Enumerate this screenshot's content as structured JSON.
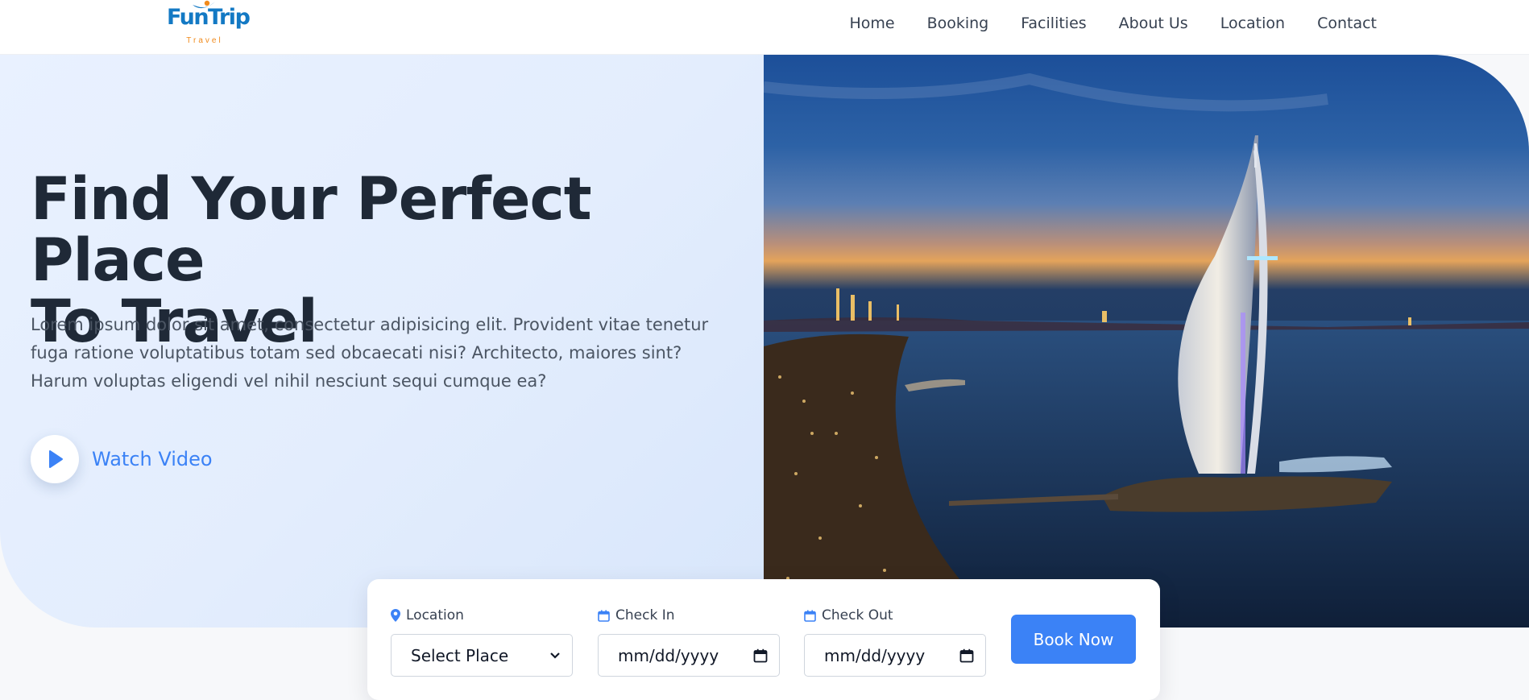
{
  "brand": {
    "name": "FunTrip",
    "tagline": "Travel",
    "primary_color": "#1379c4",
    "accent_color": "#f08a1c"
  },
  "nav": {
    "items": [
      {
        "label": "Home"
      },
      {
        "label": "Booking"
      },
      {
        "label": "Facilities"
      },
      {
        "label": "About Us"
      },
      {
        "label": "Location"
      },
      {
        "label": "Contact"
      }
    ]
  },
  "hero": {
    "title_line1": "Find Your Perfect Place",
    "title_line2": "To Travel",
    "description": "Lorem ipsum dolor sit amet, consectetur adipisicing elit. Provident vitae tenetur fuga ratione voluptatibus totam sed obcaecati nisi? Architecto, maiores sint? Harum voluptas eligendi vel nihil nesciunt sequi cumque ea?",
    "watch_video_label": "Watch Video",
    "image_icon": "burj-al-arab-night-photo"
  },
  "booking": {
    "location": {
      "label": "Location",
      "icon": "map-pin-icon",
      "value": "Select Place"
    },
    "check_in": {
      "label": "Check In",
      "icon": "calendar-icon",
      "placeholder": "mm/dd/yyyy"
    },
    "check_out": {
      "label": "Check Out",
      "icon": "calendar-icon",
      "placeholder": "mm/dd/yyyy"
    },
    "submit_label": "Book Now",
    "button_color": "#3b82f6"
  }
}
